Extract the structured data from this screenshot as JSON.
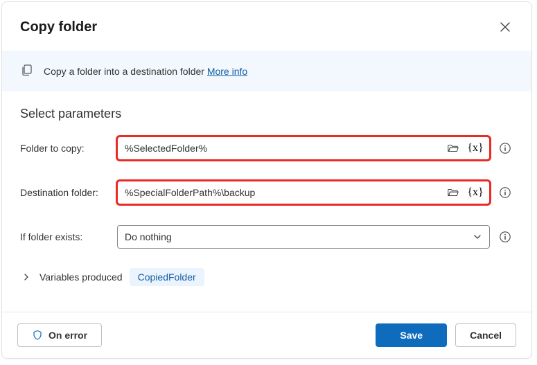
{
  "dialog": {
    "title": "Copy folder",
    "banner_text": "Copy a folder into a destination folder ",
    "more_info": "More info"
  },
  "section": {
    "title": "Select parameters"
  },
  "fields": {
    "folder_to_copy": {
      "label": "Folder to copy:",
      "value": "%SelectedFolder%"
    },
    "destination_folder": {
      "label": "Destination folder:",
      "value": "%SpecialFolderPath%\\backup"
    },
    "if_exists": {
      "label": "If folder exists:",
      "value": "Do nothing"
    }
  },
  "variables": {
    "label": "Variables produced",
    "tag": "CopiedFolder"
  },
  "footer": {
    "on_error": "On error",
    "save": "Save",
    "cancel": "Cancel"
  }
}
